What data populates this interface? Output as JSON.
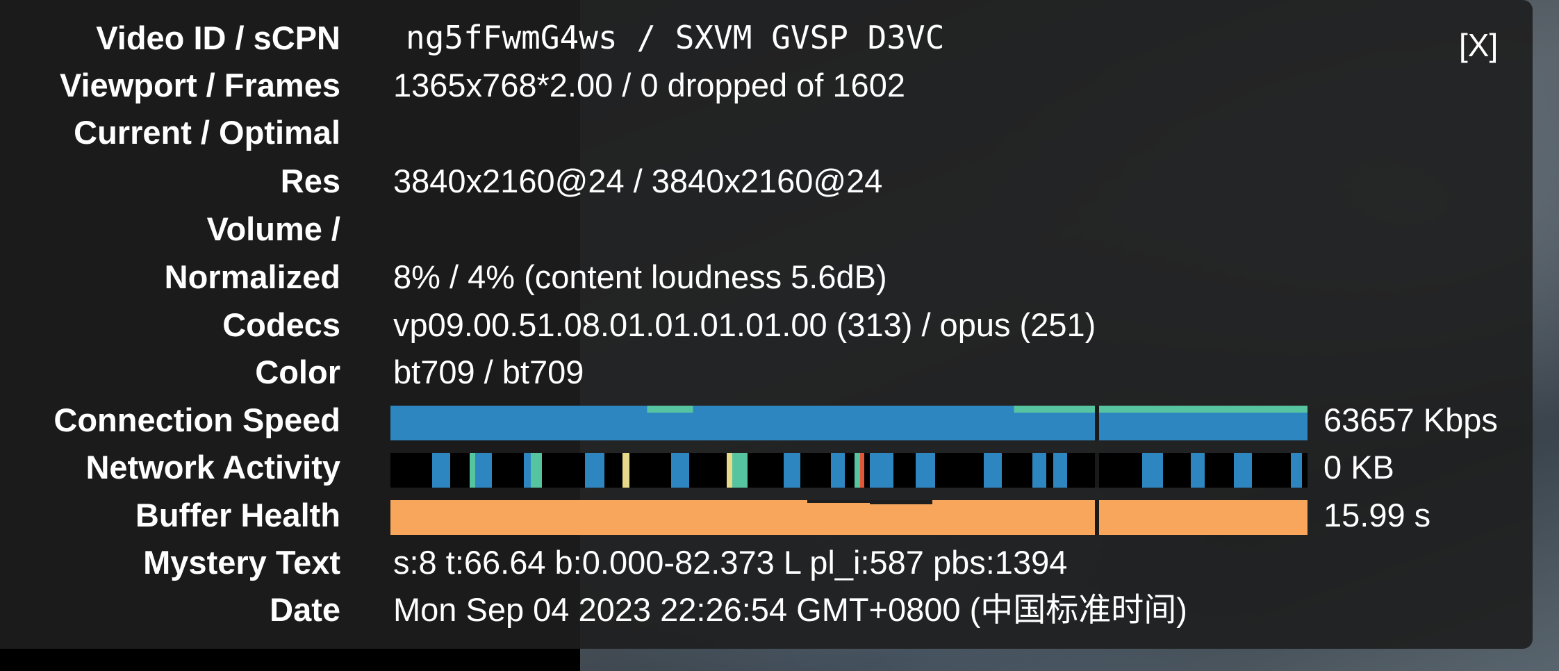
{
  "close_label": "[X]",
  "rows": {
    "video_id": {
      "label": "Video ID / sCPN",
      "value": "ng5fFwmG4ws / SXVM GVSP D3VC"
    },
    "viewport": {
      "label": "Viewport / Frames",
      "value": "1365x768*2.00 / 0 dropped of 1602"
    },
    "current_optimal": {
      "label": "Current / Optimal",
      "value": ""
    },
    "res": {
      "label": "Res",
      "value": "3840x2160@24 / 3840x2160@24"
    },
    "volume": {
      "label": "Volume /",
      "value": ""
    },
    "normalized": {
      "label": "Normalized",
      "value": "8% / 4% (content loudness 5.6dB)"
    },
    "codecs": {
      "label": "Codecs",
      "value": "vp09.00.51.08.01.01.01.01.00 (313) / opus (251)"
    },
    "color": {
      "label": "Color",
      "value": "bt709 / bt709"
    },
    "connection_speed": {
      "label": "Connection Speed",
      "value": "63657 Kbps"
    },
    "network_activity": {
      "label": "Network Activity",
      "value": "0 KB"
    },
    "buffer_health": {
      "label": "Buffer Health",
      "value": "15.99 s"
    },
    "mystery_text": {
      "label": "Mystery Text",
      "value": "s:8 t:66.64 b:0.000-82.373 L pl_i:587 pbs:1394"
    },
    "date": {
      "label": "Date",
      "value": "Mon Sep 04 2023 22:26:54 GMT+0800 (中国标准时间)"
    }
  },
  "colors": {
    "speed_bar": "#2e86c1",
    "speed_accent": "#57c4a0",
    "buffer_bar": "#f8a65c",
    "network_bar_blue": "#2e86c1",
    "network_bar_teal": "#57c4a0",
    "network_bar_yellow": "#e8d98a",
    "network_bar_red": "#e2563a"
  }
}
